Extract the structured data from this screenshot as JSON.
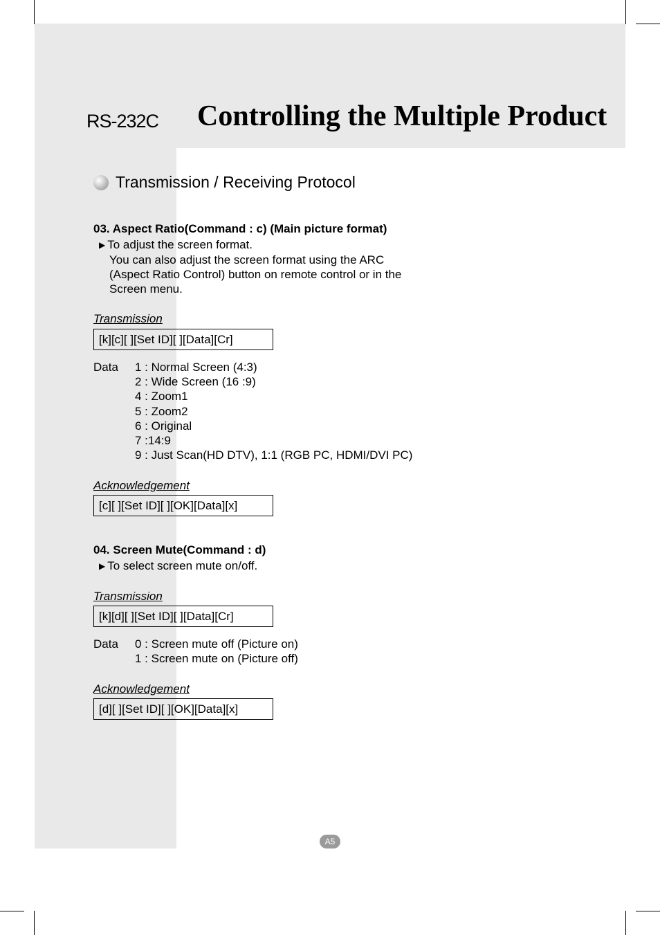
{
  "header": {
    "label": "RS-232C",
    "title": "Controlling the Multiple Product"
  },
  "section_heading": "Transmission / Receiving Protocol",
  "cmd03": {
    "title": "03. Aspect Ratio(Command : c) (Main picture format)",
    "bullet": "To adjust the screen format.",
    "desc1": "You can also adjust the screen format using the ARC",
    "desc2": "(Aspect Ratio Control) button on remote control or in the",
    "desc3": "Screen menu.",
    "transmission_label": "Transmission",
    "transmission_code": "[k][c][ ][Set ID][ ][Data][Cr]",
    "data_prefix": "Data",
    "data": [
      "1 : Normal Screen (4:3)",
      "2 : Wide Screen (16 :9)",
      "4 : Zoom1",
      "5 : Zoom2",
      "6 : Original",
      "7 :14:9",
      "9 : Just Scan(HD DTV), 1:1 (RGB PC, HDMI/DVI PC)"
    ],
    "ack_label": "Acknowledgement",
    "ack_code": "[c][ ][Set ID][ ][OK][Data][x]"
  },
  "cmd04": {
    "title": "04. Screen Mute(Command : d)",
    "bullet": "To select screen mute on/off.",
    "transmission_label": "Transmission",
    "transmission_code": "[k][d][ ][Set ID][ ][Data][Cr]",
    "data_prefix": "Data",
    "data": [
      "0 : Screen mute off (Picture on)",
      "1 : Screen mute on (Picture off)"
    ],
    "ack_label": "Acknowledgement",
    "ack_code": "[d][ ][Set ID][ ][OK][Data][x]"
  },
  "page_number": "A5"
}
